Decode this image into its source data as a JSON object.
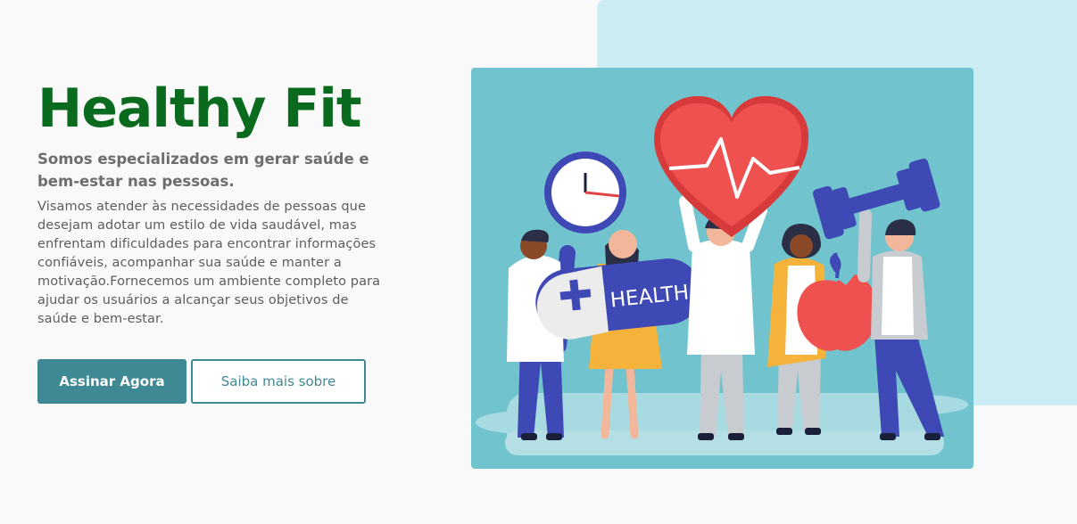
{
  "hero": {
    "title": "Healthy Fit",
    "subtitle": "Somos especializados em gerar saúde e bem-estar nas pessoas.",
    "description": "Visamos atender às necessidades de pessoas que desejam adotar um estilo de vida saudável, mas enfrentam dificuldades para encontrar informações confiáveis, acompanhar sua saúde e manter a motivação.Fornecemos um ambiente completo para ajudar os usuários a alcançar seus objetivos de saúde e bem-estar.",
    "primary_button": "Assinar Agora",
    "secondary_button": "Saiba mais sobre"
  },
  "illustration": {
    "pill_label": "HEALTH",
    "icons": [
      "clock-icon",
      "heart-pulse-icon",
      "dumbbell-icon",
      "apple-icon",
      "health-pill-icon"
    ]
  },
  "colors": {
    "title": "#0a6a1e",
    "accent": "#3f8994",
    "background_block": "#cdedf4",
    "illustration_bg": "#71c4cd"
  }
}
